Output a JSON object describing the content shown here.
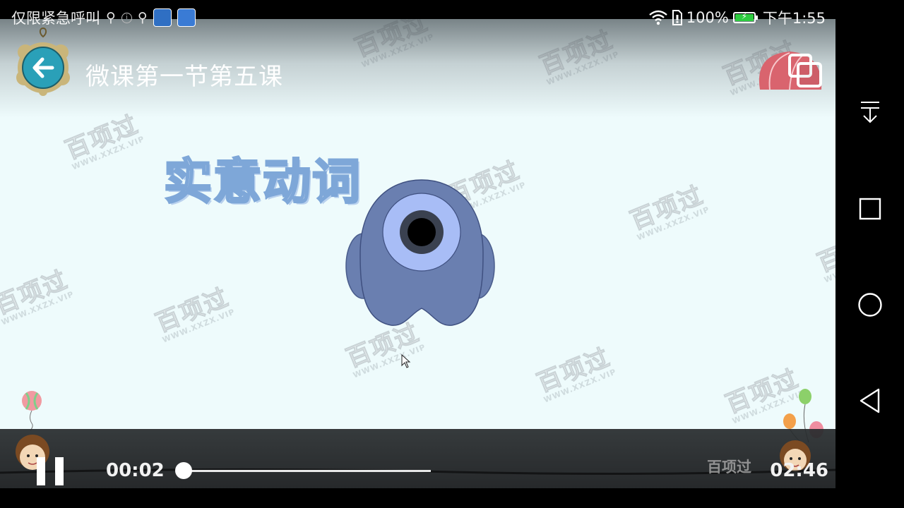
{
  "status_bar": {
    "carrier_text": "仅限紧急呼叫",
    "battery_percent": "100%",
    "battery_level": 1.0,
    "time": "下午1:55",
    "icons": [
      "usb-icon",
      "info-icon",
      "usb-icon",
      "app-notification-icon",
      "app-notification-icon",
      "wifi-icon",
      "sim-icon",
      "battery-charging-icon"
    ]
  },
  "video": {
    "title": "微课第一节第五课",
    "slide_heading": "实意动词",
    "watermark_text": "百项过",
    "watermark_url": "WWW.XXZX.VIP",
    "background_color": "#eefbfc",
    "character_color": "#6a7fb0",
    "eye_color": "#a8bdf6"
  },
  "controls": {
    "current_time": "00:02",
    "total_time": "02:46",
    "progress": 0.012,
    "buffered": 1.0,
    "footer_brand": "百项过",
    "play_state": "pause-icon"
  },
  "nav_bar": {
    "buttons": [
      "pull-down-icon",
      "recent-apps-icon",
      "home-icon",
      "back-icon"
    ]
  }
}
